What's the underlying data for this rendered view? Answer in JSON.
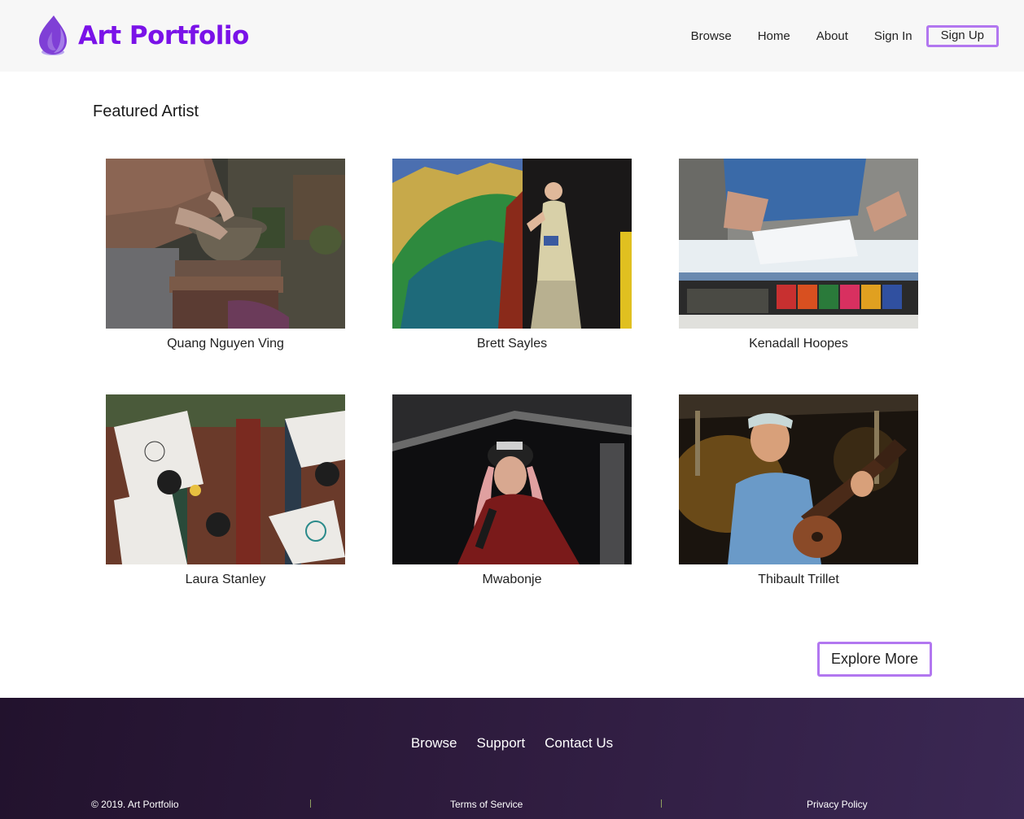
{
  "header": {
    "logo_text": "Art Portfolio",
    "logo_icon": "flame-drop-icon",
    "brand_color": "#7a12e8",
    "nav": [
      "Browse",
      "Home",
      "About",
      "Sign In"
    ],
    "signup_label": "Sign Up"
  },
  "main": {
    "title": "Featured Artist",
    "artists": [
      {
        "name": "Quang Nguyen Ving",
        "photo": "pottery-wheel-photo"
      },
      {
        "name": "Brett Sayles",
        "photo": "mural-painter-photo"
      },
      {
        "name": "Kenadall Hoopes",
        "photo": "drawing-table-photo"
      },
      {
        "name": "Laura Stanley",
        "photo": "floral-sketches-photo"
      },
      {
        "name": "Mwabonje",
        "photo": "singer-microphone-photo"
      },
      {
        "name": "Thibault Trillet",
        "photo": "ukulele-player-photo"
      }
    ],
    "explore_label": "Explore More",
    "accent_color": "#b277f0"
  },
  "footer": {
    "nav": [
      "Browse",
      "Support",
      "Contact Us"
    ],
    "copyright": "© 2019. Art Portfolio",
    "terms": "Terms of Service",
    "privacy": "Privacy Policy"
  }
}
